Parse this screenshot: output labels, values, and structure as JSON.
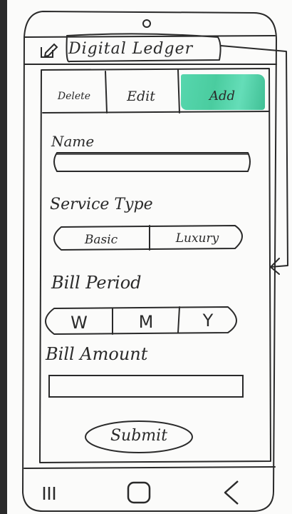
{
  "app": {
    "title": "Digital Ledger"
  },
  "tabs": [
    {
      "label": "Delete",
      "active": false
    },
    {
      "label": "Edit",
      "active": false
    },
    {
      "label": "Add",
      "active": true
    }
  ],
  "form": {
    "name_label": "Name",
    "name_value": "",
    "service_type_label": "Service Type",
    "service_options": [
      "Basic",
      "Luxury"
    ],
    "bill_period_label": "Bill Period",
    "bill_period_options": [
      "W",
      "M",
      "Y"
    ],
    "bill_amount_label": "Bill Amount",
    "bill_amount_value": "",
    "submit_label": "Submit"
  },
  "icons": {
    "edit": "edit-icon",
    "recent": "recent-apps-icon",
    "home": "home-icon",
    "back": "back-icon"
  },
  "colors": {
    "active_tab_highlight": "#2bc48f",
    "ink": "#2a2a2a",
    "paper": "#fbfbfa"
  }
}
